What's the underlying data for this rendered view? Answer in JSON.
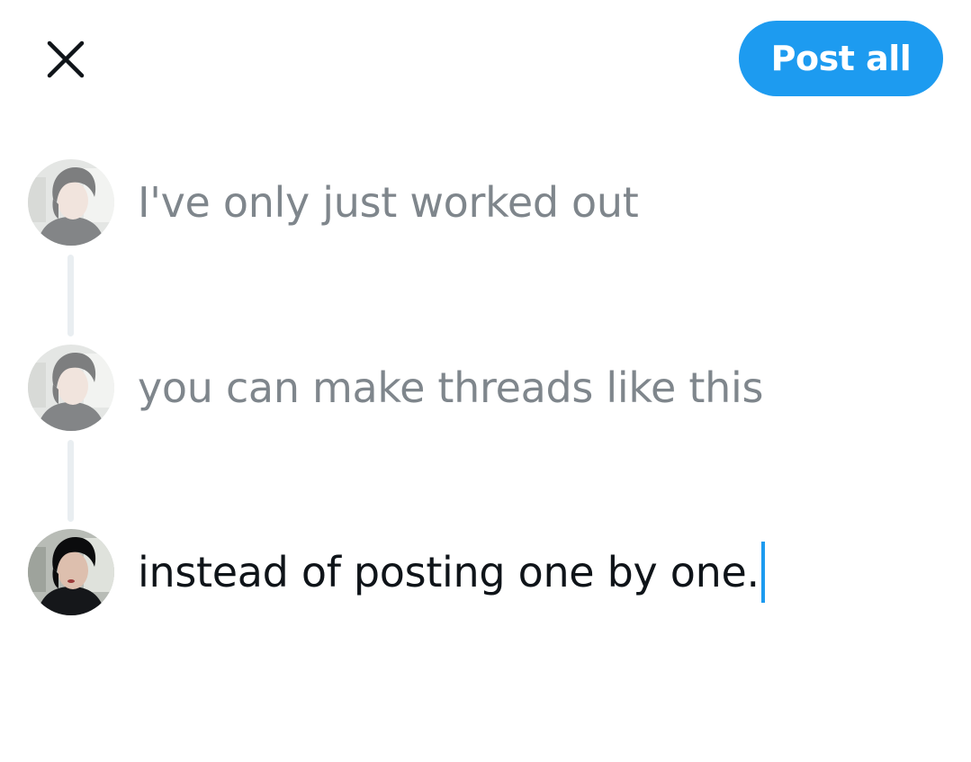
{
  "header": {
    "close_icon": "close-icon",
    "post_all_label": "Post all",
    "accent_color": "#1d9bf0"
  },
  "thread": {
    "posts": [
      {
        "text": "I've only just worked out",
        "state": "inactive"
      },
      {
        "text": "you can make threads like this",
        "state": "inactive"
      },
      {
        "text": "instead of posting one by one.",
        "state": "active"
      }
    ]
  }
}
